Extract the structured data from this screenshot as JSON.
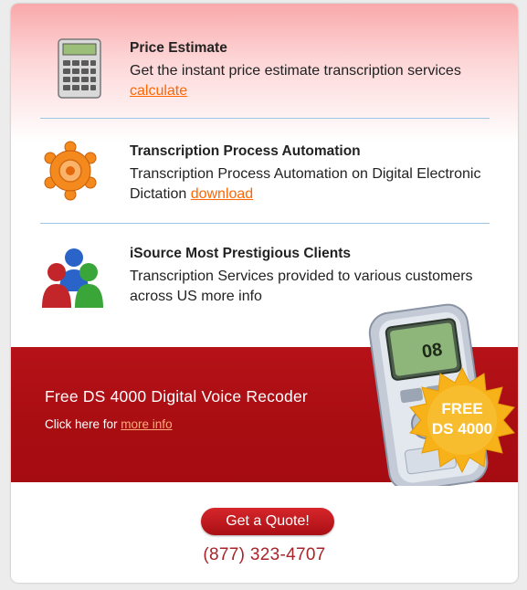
{
  "items": [
    {
      "title": "Price Estimate",
      "desc_text": "Get the instant price estimate transcription services",
      "link": "calculate",
      "icon": "calculator-icon"
    },
    {
      "title": "Transcription Process Automation",
      "desc_text": "Transcription Process Automation on Digital Electronic Dictation",
      "link": "download",
      "icon": "gear-icon"
    },
    {
      "title": "iSource Most Prestigious Clients",
      "desc_text": "Transcription Services provided to various customers across US more info",
      "link": "",
      "icon": "users-icon"
    }
  ],
  "banner": {
    "title": "Free DS 4000 Digital Voice Recoder",
    "sub_prefix": "Click here for",
    "sub_link": "more info",
    "badge_line1": "FREE",
    "badge_line2": "DS 4000",
    "device_screen_text": "08"
  },
  "quote_button": "Get a Quote!",
  "phone": "(877) 323-4707",
  "colors": {
    "accent_link": "#ff6600",
    "banner_red": "#a80d12",
    "phone_red": "#a8242a",
    "badge_gold": "#f7b21a",
    "divider_blue": "#9ec6e6"
  }
}
